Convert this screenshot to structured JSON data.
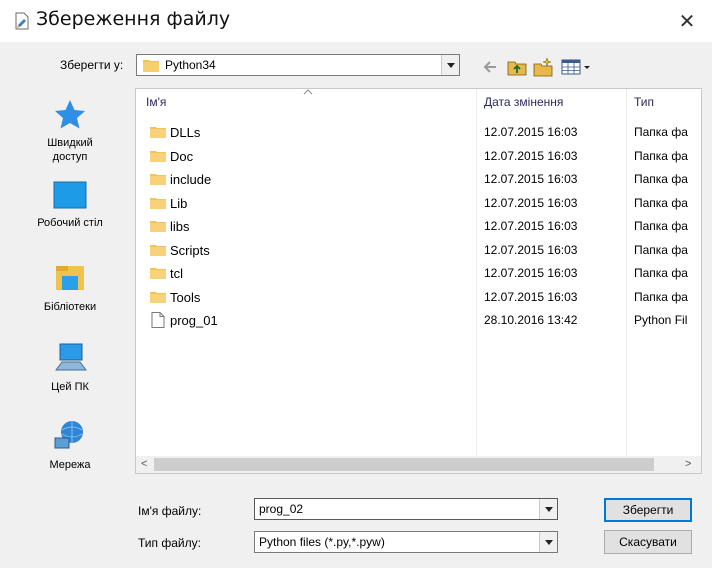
{
  "window": {
    "title": "Збереження файлу",
    "close_glyph": "✕"
  },
  "save_in": {
    "label": "Зберегти у:",
    "folder": "Python34"
  },
  "places": [
    {
      "label_line1": "Швидкий",
      "label_line2": "доступ",
      "icon": "star-icon"
    },
    {
      "label_line1": "Робочий стіл",
      "label_line2": "",
      "icon": "desktop-icon"
    },
    {
      "label_line1": "Бібліотеки",
      "label_line2": "",
      "icon": "libraries-icon"
    },
    {
      "label_line1": "Цей ПК",
      "label_line2": "",
      "icon": "computer-icon"
    },
    {
      "label_line1": "Мережа",
      "label_line2": "",
      "icon": "network-icon"
    }
  ],
  "columns": {
    "name": "Ім'я",
    "date": "Дата змінення",
    "type": "Тип"
  },
  "files": [
    {
      "name": "DLLs",
      "date": "12.07.2015 16:03",
      "type": "Папка фа",
      "kind": "folder"
    },
    {
      "name": "Doc",
      "date": "12.07.2015 16:03",
      "type": "Папка фа",
      "kind": "folder"
    },
    {
      "name": "include",
      "date": "12.07.2015 16:03",
      "type": "Папка фа",
      "kind": "folder"
    },
    {
      "name": "Lib",
      "date": "12.07.2015 16:03",
      "type": "Папка фа",
      "kind": "folder"
    },
    {
      "name": "libs",
      "date": "12.07.2015 16:03",
      "type": "Папка фа",
      "kind": "folder"
    },
    {
      "name": "Scripts",
      "date": "12.07.2015 16:03",
      "type": "Папка фа",
      "kind": "folder"
    },
    {
      "name": "tcl",
      "date": "12.07.2015 16:03",
      "type": "Папка фа",
      "kind": "folder"
    },
    {
      "name": "Tools",
      "date": "12.07.2015 16:03",
      "type": "Папка фа",
      "kind": "folder"
    },
    {
      "name": "prog_01",
      "date": "28.10.2016 13:42",
      "type": "Python Fil",
      "kind": "file"
    }
  ],
  "filename": {
    "label": "Ім'я файлу:",
    "value": "prog_02"
  },
  "filetype": {
    "label": "Тип файлу:",
    "value": "Python files (*.py,*.pyw)"
  },
  "buttons": {
    "save": "Зберегти",
    "cancel": "Скасувати"
  },
  "scroll": {
    "left": "<",
    "right": ">"
  },
  "colors": {
    "folder": "#f3c35a",
    "accent": "#0078d7"
  }
}
